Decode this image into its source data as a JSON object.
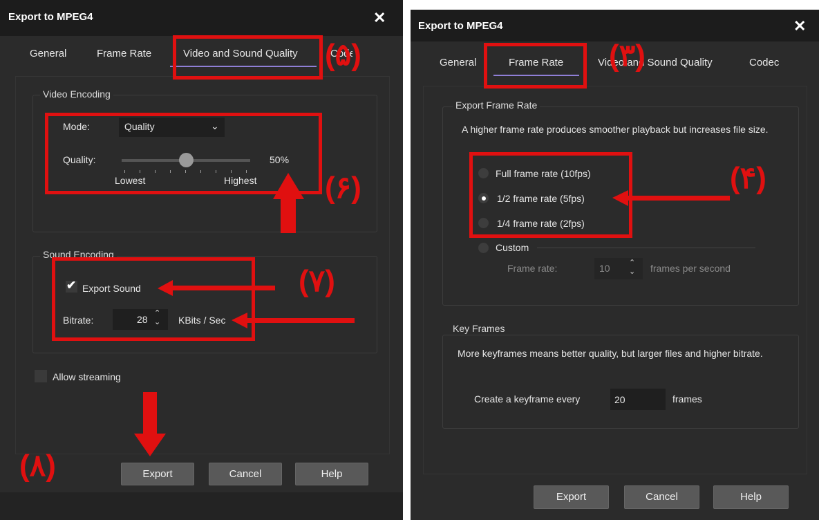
{
  "left": {
    "title": "Export to MPEG4",
    "close": "✕",
    "tabs": [
      "General",
      "Frame Rate",
      "Video and Sound Quality",
      "Codec"
    ],
    "video_encoding": {
      "legend": "Video Encoding",
      "mode_label": "Mode:",
      "mode_value": "Quality",
      "quality_label": "Quality:",
      "quality_value": "50%",
      "quality_level": 0.5,
      "lowest": "Lowest",
      "highest": "Highest"
    },
    "sound_encoding": {
      "legend": "Sound Encoding",
      "export_sound": "Export Sound",
      "export_sound_checked": true,
      "bitrate_label": "Bitrate:",
      "bitrate_value": "28",
      "bitrate_unit": "KBits / Sec"
    },
    "allow_streaming": "Allow streaming",
    "buttons": {
      "export": "Export",
      "cancel": "Cancel",
      "help": "Help"
    },
    "annotations": {
      "n5": "(۵)",
      "n6": "(۶)",
      "n7": "(۷)",
      "n8": "(۸)"
    }
  },
  "right": {
    "title": "Export to MPEG4",
    "close": "✕",
    "tabs": [
      "General",
      "Frame Rate",
      "Video and Sound Quality",
      "Codec"
    ],
    "export_frame_rate": {
      "legend": "Export Frame Rate",
      "description": "A higher frame rate produces smoother playback but increases file size.",
      "options": [
        "Full frame rate (10fps)",
        "1/2 frame rate (5fps)",
        "1/4 frame rate (2fps)",
        "Custom"
      ],
      "selected_index": 1,
      "frame_rate_label": "Frame rate:",
      "frame_rate_value": "10",
      "frame_rate_unit": "frames per second"
    },
    "key_frames": {
      "legend": "Key Frames",
      "description": "More keyframes means better quality, but larger files and higher bitrate.",
      "create_label": "Create a keyframe every",
      "value": "20",
      "unit": "frames"
    },
    "buttons": {
      "export": "Export",
      "cancel": "Cancel",
      "help": "Help"
    },
    "annotations": {
      "n3": "(۳)",
      "n4": "(۴)"
    }
  },
  "colors": {
    "annotation_red": "#e01010",
    "tab_underline": "#8f7fd6",
    "dialog_bg": "#2b2b2b"
  }
}
